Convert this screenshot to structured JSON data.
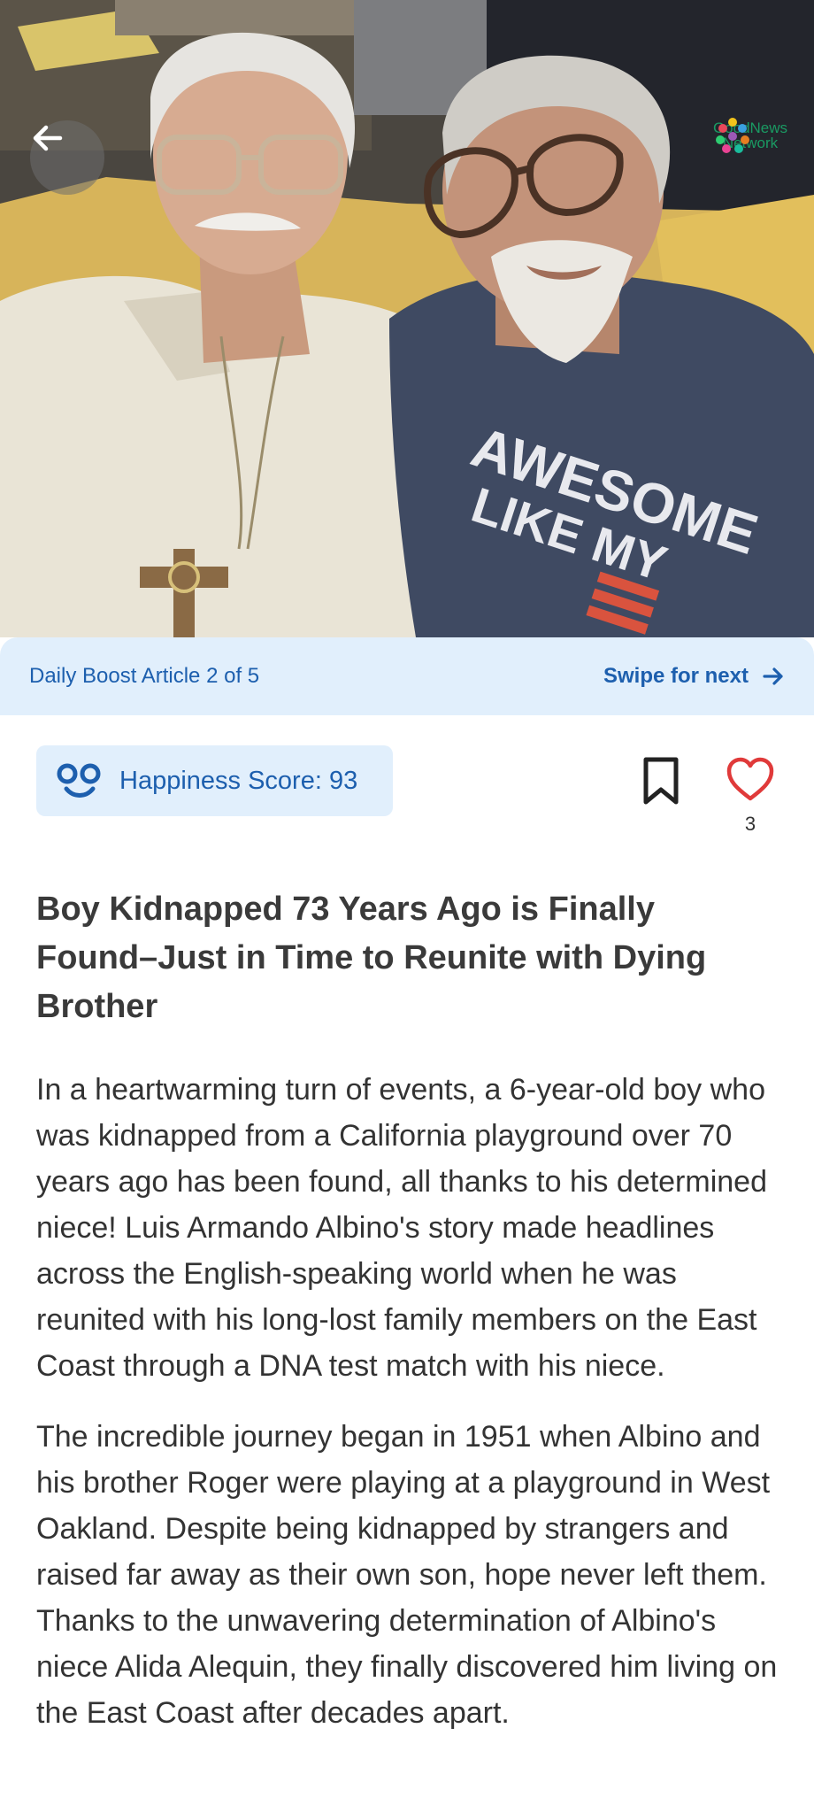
{
  "hero": {
    "photo_description_icon": "photo-icon",
    "back_icon": "arrow-left-icon",
    "watermark": {
      "text": "GoodNews\nNetwork",
      "icon": "flower-logo-icon"
    },
    "shirt_text_line1": "AWESOME",
    "shirt_text_line2": "LIKE MY"
  },
  "banner": {
    "article_label": "Daily Boost Article 2 of 5",
    "swipe_label": "Swipe for next",
    "swipe_icon": "arrow-right-icon"
  },
  "score": {
    "icon": "smiley-icon",
    "label": "Happiness Score: 93"
  },
  "actions": {
    "bookmark_icon": "bookmark-icon",
    "like_icon": "heart-icon",
    "like_count": "3"
  },
  "article": {
    "headline": "Boy Kidnapped 73 Years Ago is Finally Found–Just in Time to Reunite with Dying Brother",
    "paragraphs": [
      "In a heartwarming turn of events, a 6-year-old boy who was kidnapped from a California playground over 70 years ago has been found, all thanks to his determined niece! Luis Armando Albino's story made headlines across the English-speaking world when he was reunited with his long-lost family members on the East Coast through a DNA test match with his niece.",
      "The incredible journey began in 1951 when Albino and his brother Roger were playing at a playground in West Oakland. Despite being kidnapped by strangers and raised far away as their own son, hope never left them. Thanks to the unwavering determination of Albino's niece Alida Alequin, they finally discovered him living on the East Coast after decades apart."
    ]
  },
  "colors": {
    "accent": "#1d5fae",
    "banner_bg": "#e1effc",
    "heart": "#e03a3a",
    "watermark": "#1a9a63"
  }
}
